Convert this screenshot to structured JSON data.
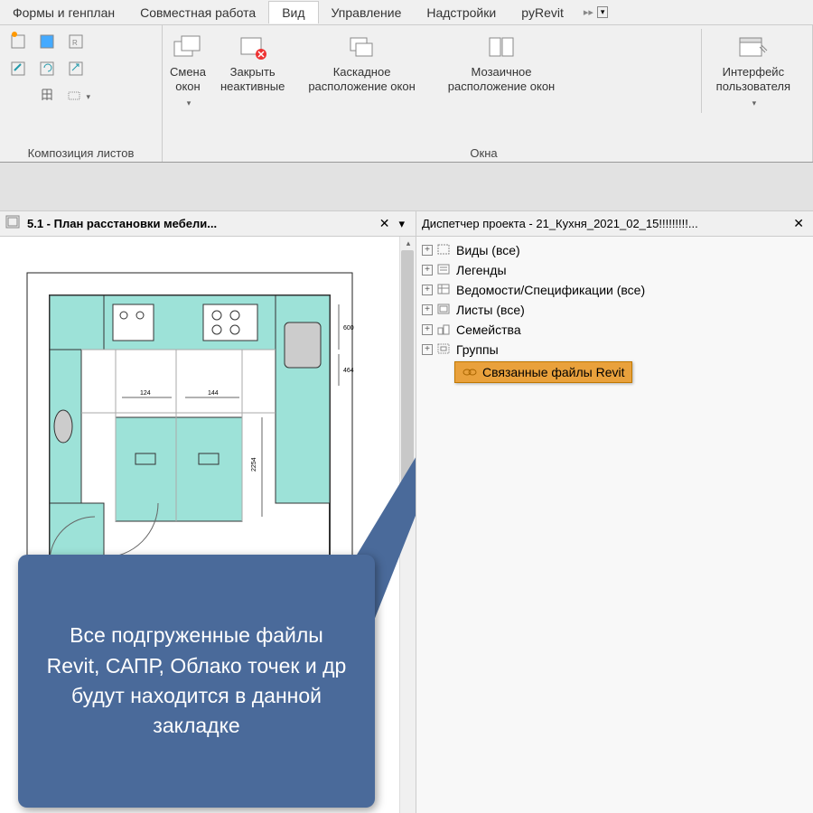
{
  "ribbonTabs": {
    "formsAndPlan": "Формы и генплан",
    "collab": "Совместная работа",
    "view": "Вид",
    "manage": "Управление",
    "addins": "Надстройки",
    "pyrevit": "pyRevit"
  },
  "ribbonGroups": {
    "sheetComp": "Композиция листов",
    "windows": "Окна"
  },
  "ribbonButtons": {
    "switchWindows": "Смена\nокон",
    "closeInactive": "Закрыть\nнеактивные",
    "cascade": "Каскадное\nрасположение окон",
    "tile": "Мозаичное\nрасположение окон",
    "ui": "Интерфейс\nпользователя"
  },
  "leftPanel": {
    "title": "5.1 - План расстановки мебели..."
  },
  "rightPanel": {
    "title": "Диспетчер проекта - 21_Кухня_2021_02_15!!!!!!!!!..."
  },
  "tree": {
    "views": "Виды (все)",
    "legends": "Легенды",
    "schedules": "Ведомости/Спецификации (все)",
    "sheets": "Листы (все)",
    "families": "Семейства",
    "groups": "Группы",
    "linked": "Связанные файлы Revit"
  },
  "callout": {
    "text": "Все подгруженные файлы Revit, САПР, Облако точек и др будут находится в данной закладке"
  }
}
